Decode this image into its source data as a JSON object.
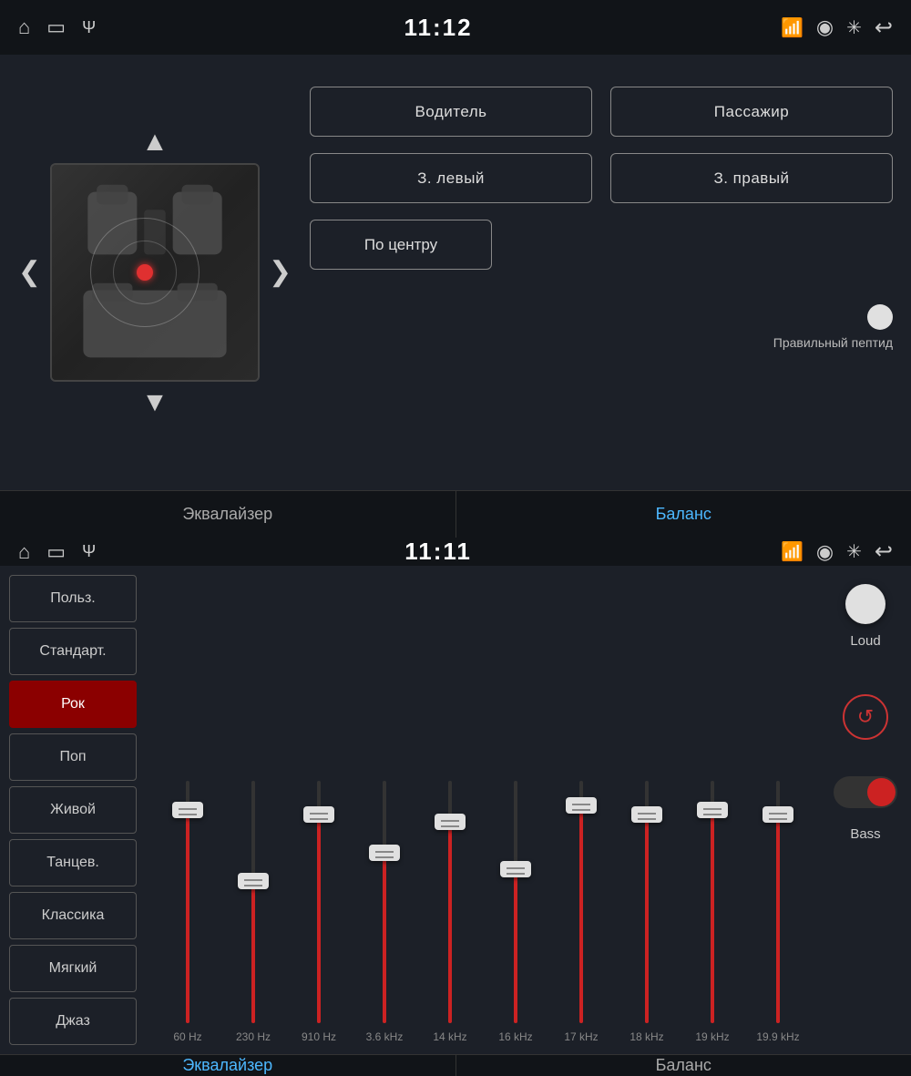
{
  "top_screen": {
    "status": {
      "time": "11:12"
    },
    "car_area": {
      "up_arrow": "▲",
      "down_arrow": "▼",
      "left_arrow": "❮",
      "right_arrow": "❯"
    },
    "buttons": {
      "driver": "Водитель",
      "passenger": "Пассажир",
      "rear_left": "З. левый",
      "rear_right": "З. правый",
      "center": "По центру",
      "correct_label": "Правильный пептид"
    },
    "tabs": {
      "equalizer": "Эквалайзер",
      "balance": "Баланс",
      "active": "balance"
    }
  },
  "bottom_screen": {
    "status": {
      "time": "11:11"
    },
    "presets": [
      {
        "id": "polz",
        "label": "Польз."
      },
      {
        "id": "standart",
        "label": "Стандарт."
      },
      {
        "id": "rok",
        "label": "Рок",
        "active": true
      },
      {
        "id": "pop",
        "label": "Поп"
      },
      {
        "id": "zhivoy",
        "label": "Живой"
      },
      {
        "id": "tants",
        "label": "Танцев."
      },
      {
        "id": "klassika",
        "label": "Классика"
      },
      {
        "id": "myagkiy",
        "label": "Мягкий"
      },
      {
        "id": "dzhaz",
        "label": "Джаз"
      }
    ],
    "sliders": [
      {
        "freq": "60",
        "unit": "Hz",
        "fill_pct": 90,
        "thumb_pct": 90
      },
      {
        "freq": "230",
        "unit": "Hz",
        "fill_pct": 60,
        "thumb_pct": 60
      },
      {
        "freq": "910",
        "unit": "Hz",
        "fill_pct": 88,
        "thumb_pct": 88
      },
      {
        "freq": "3.6",
        "unit": "kHz",
        "fill_pct": 72,
        "thumb_pct": 72
      },
      {
        "freq": "14",
        "unit": "kHz",
        "fill_pct": 85,
        "thumb_pct": 85
      },
      {
        "freq": "16",
        "unit": "kHz",
        "fill_pct": 65,
        "thumb_pct": 65
      },
      {
        "freq": "17",
        "unit": "kHz",
        "fill_pct": 92,
        "thumb_pct": 92
      },
      {
        "freq": "18",
        "unit": "kHz",
        "fill_pct": 88,
        "thumb_pct": 88
      },
      {
        "freq": "19",
        "unit": "kHz",
        "fill_pct": 90,
        "thumb_pct": 90
      },
      {
        "freq": "19.9",
        "unit": "kHz",
        "fill_pct": 88,
        "thumb_pct": 88
      }
    ],
    "controls": {
      "loud_label": "Loud",
      "bass_label": "Bass"
    },
    "tabs": {
      "equalizer": "Эквалайзер",
      "balance": "Баланс",
      "active": "equalizer"
    }
  },
  "icons": {
    "home": "⌂",
    "screen": "▭",
    "usb": "Ψ",
    "cast": "⊡",
    "location": "◉",
    "bluetooth": "ʙ",
    "back": "↩"
  }
}
